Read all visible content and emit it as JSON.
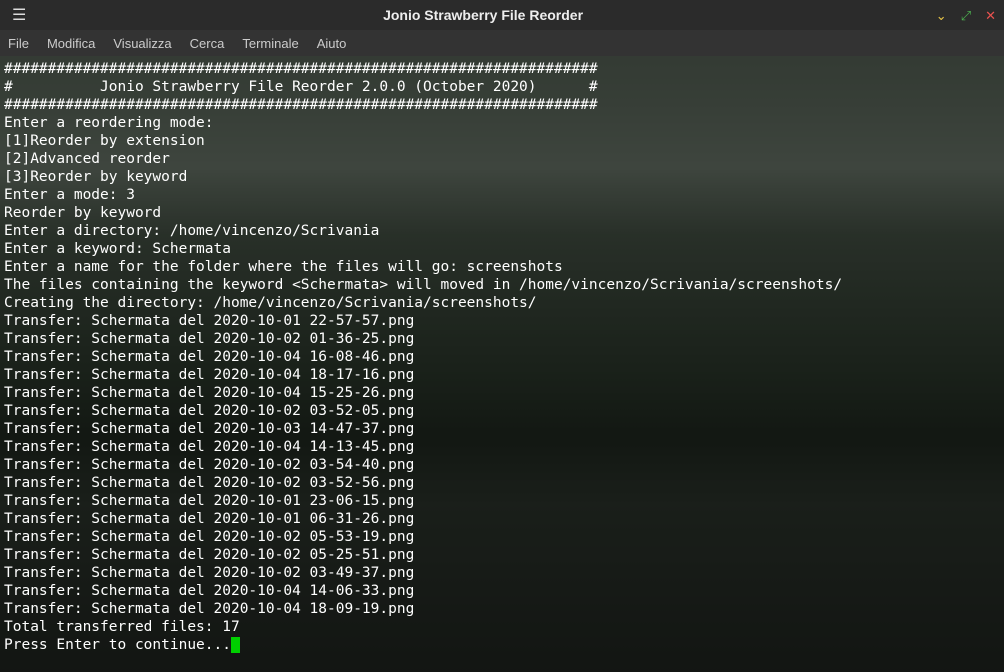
{
  "titlebar": {
    "title": "Jonio Strawberry File Reorder"
  },
  "menubar": {
    "items": [
      "File",
      "Modifica",
      "Visualizza",
      "Cerca",
      "Terminale",
      "Aiuto"
    ]
  },
  "terminal": {
    "lines": [
      "####################################################################",
      "#          Jonio Strawberry File Reorder 2.0.0 (October 2020)      #",
      "####################################################################",
      "Enter a reordering mode:",
      "[1]Reorder by extension",
      "[2]Advanced reorder",
      "[3]Reorder by keyword",
      "Enter a mode: 3",
      "Reorder by keyword",
      "Enter a directory: /home/vincenzo/Scrivania",
      "Enter a keyword: Schermata",
      "Enter a name for the folder where the files will go: screenshots",
      "The files containing the keyword <Schermata> will moved in /home/vincenzo/Scrivania/screenshots/",
      "Creating the directory: /home/vincenzo/Scrivania/screenshots/",
      "Transfer: Schermata del 2020-10-01 22-57-57.png",
      "Transfer: Schermata del 2020-10-02 01-36-25.png",
      "Transfer: Schermata del 2020-10-04 16-08-46.png",
      "Transfer: Schermata del 2020-10-04 18-17-16.png",
      "Transfer: Schermata del 2020-10-04 15-25-26.png",
      "Transfer: Schermata del 2020-10-02 03-52-05.png",
      "Transfer: Schermata del 2020-10-03 14-47-37.png",
      "Transfer: Schermata del 2020-10-04 14-13-45.png",
      "Transfer: Schermata del 2020-10-02 03-54-40.png",
      "Transfer: Schermata del 2020-10-02 03-52-56.png",
      "Transfer: Schermata del 2020-10-01 23-06-15.png",
      "Transfer: Schermata del 2020-10-01 06-31-26.png",
      "Transfer: Schermata del 2020-10-02 05-53-19.png",
      "Transfer: Schermata del 2020-10-02 05-25-51.png",
      "Transfer: Schermata del 2020-10-02 03-49-37.png",
      "Transfer: Schermata del 2020-10-04 14-06-33.png",
      "Transfer: Schermata del 2020-10-04 18-09-19.png",
      "Total transferred files: 17",
      "Press Enter to continue..."
    ]
  }
}
